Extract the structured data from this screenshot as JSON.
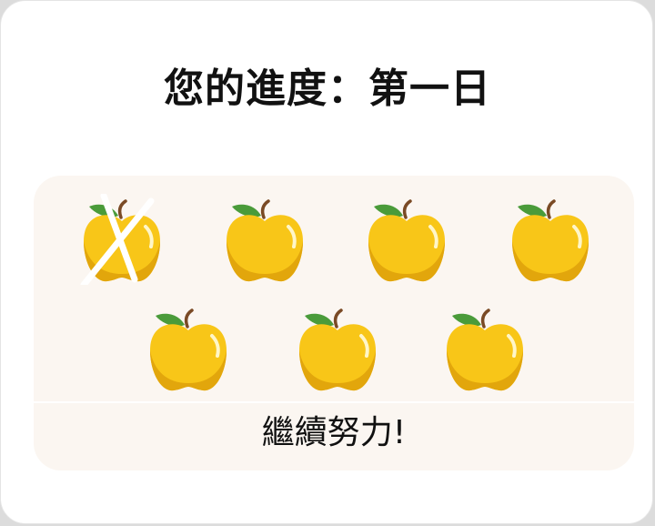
{
  "title": "您的進度：第一日",
  "footer": "繼續努力!",
  "progress": {
    "total": 7,
    "crossed_out": 1
  },
  "apples": [
    {
      "state": "crossed"
    },
    {
      "state": "remaining"
    },
    {
      "state": "remaining"
    },
    {
      "state": "remaining"
    },
    {
      "state": "remaining"
    },
    {
      "state": "remaining"
    },
    {
      "state": "remaining"
    }
  ],
  "colors": {
    "apple": "#f8c618",
    "apple_shade": "#e2a60c",
    "leaf": "#4a9b3a",
    "stem": "#7a4a25",
    "panel": "#fbf6f1",
    "cross": "#ffffff",
    "text": "#111111"
  }
}
